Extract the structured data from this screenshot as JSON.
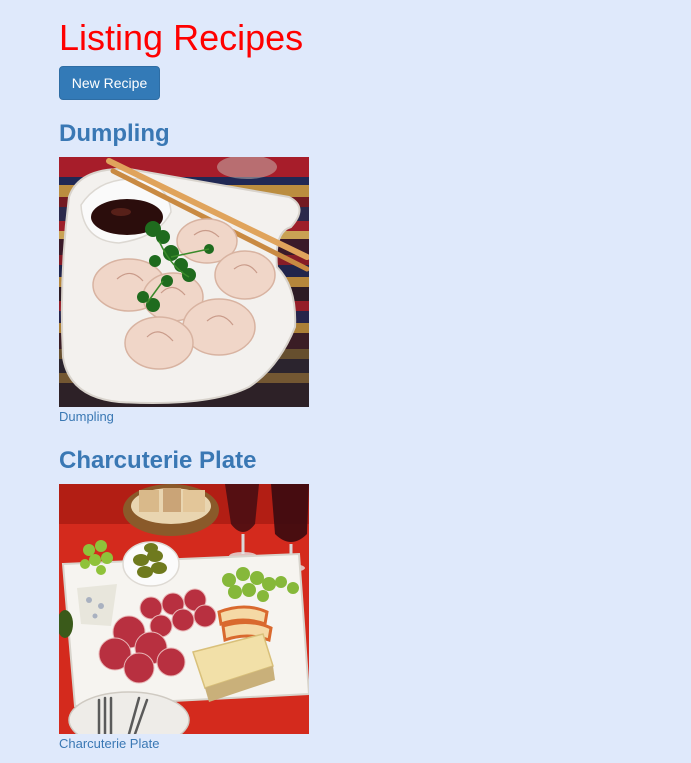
{
  "page": {
    "title": "Listing Recipes"
  },
  "toolbar": {
    "new_recipe_label": "New Recipe"
  },
  "recipes": [
    {
      "title": "Dumpling",
      "caption": "Dumpling",
      "image_alt": "dumplings-photo"
    },
    {
      "title": "Charcuterie Plate",
      "caption": "Charcuterie Plate",
      "image_alt": "charcuterie-plate-photo"
    }
  ],
  "colors": {
    "background": "#dfe9fb",
    "title": "#ff0000",
    "link": "#3a78b4",
    "button": "#337ab7"
  }
}
